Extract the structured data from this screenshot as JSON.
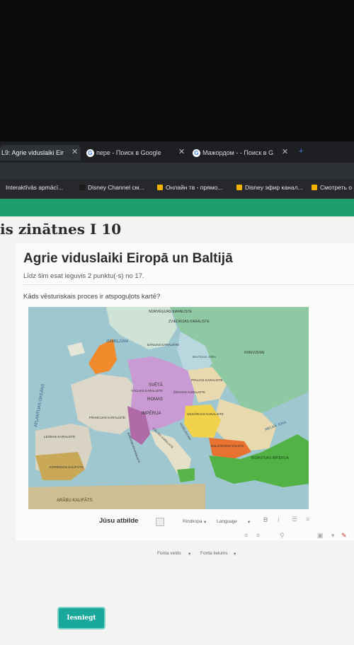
{
  "browser": {
    "tabs": [
      {
        "label": "L9: Agrie viduslaiki Eir",
        "active": true
      },
      {
        "label": "пере - Поиск в Google",
        "active": false
      },
      {
        "label": "Мажордом - - Поиск в G",
        "active": false
      }
    ],
    "new_tab": "+",
    "close_glyph": "✕",
    "bookmarks": [
      {
        "label": "Interaktīvās apmācī..."
      },
      {
        "label": "Disney Channel см..."
      },
      {
        "label": "Онлайн тв - прямо..."
      },
      {
        "label": "Disney эфир канал..."
      },
      {
        "label": "Смотреть о"
      }
    ]
  },
  "course": {
    "title": "is zinātnes I 10"
  },
  "quiz": {
    "title": "Agrie viduslaiki Eiropā un Baltijā",
    "score_text": "Līdz šim esat ieguvis 2 punktu(-s) no 17.",
    "question": "Kāds vēsturiskais proces ir atspoguļots kartē?"
  },
  "map": {
    "labels": {
      "norway": "NORVĒĢIJAS KARALISTE",
      "sweden": "ZVIEDRIJAS KARALISTE",
      "baltic": "BALTIJAS JŪRA",
      "north_sea": "ZIEMEĻJŪRA",
      "denmark": "DĀNIJAS KARALISTE",
      "russia": "KRIEVZEME",
      "poland": "POLIJAS KARALISTE",
      "hre1": "SVĒTĀ",
      "hre2": "VĀCIJAS KARALISTE",
      "hre3": "ROMAS",
      "hre4": "ČEHIJAS KARALISTE",
      "hre5": "IMPĒRIJA",
      "hungary": "UNGĀRIJAS KARALISTE",
      "france": "FRANCIJAS KARALISTE",
      "burgundy": "BURGUNDIJAS KARALISTE",
      "italy": "ITĀLIJAS KARALISTE",
      "bulgaria": "BULGĀRIJAS VALSTS",
      "byzantine": "BIZANTIJAS IMPĒRIJA",
      "leon": "LEONAS KARALISTE",
      "cordoba": "KORDOVAS KALIFĀTS",
      "arab": "ARĀBU KALIFĀTS",
      "atlantic": "ATLANTIJAS OKEĀNS",
      "black_sea": "MELNĀ JŪRA",
      "venice": "VENĒCIJAS REP."
    }
  },
  "answer": {
    "label": "Jūsu atbilde",
    "toolbar": {
      "paragraph": "Rindkopa",
      "language": "Language",
      "bold": "B",
      "italic": "I",
      "font_family": "Fonta veids",
      "font_size": "Fonta lielums"
    },
    "submit": "Iesniegt"
  }
}
